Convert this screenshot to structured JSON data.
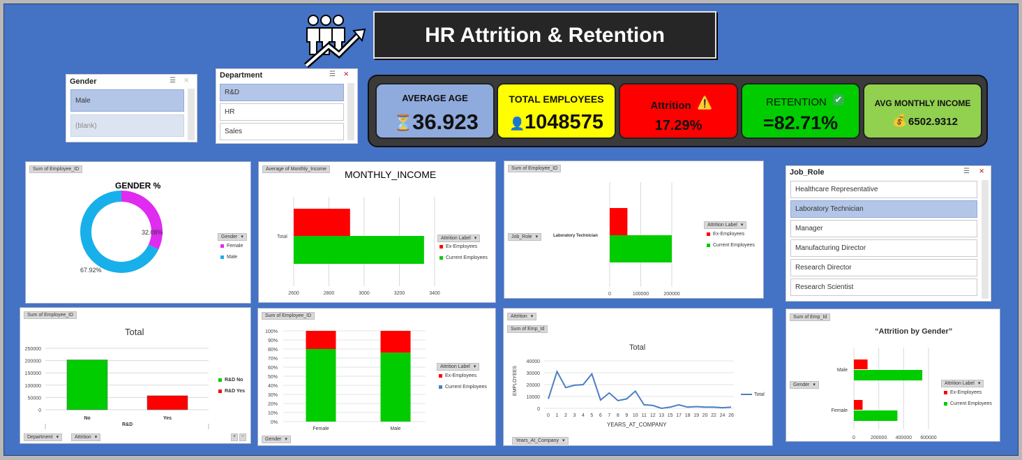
{
  "title": "HR Attrition & Retention",
  "colors": {
    "background": "#4472c4",
    "red": "#ff0000",
    "green": "#00cc00",
    "blue": "#4a7fc4",
    "magenta": "#e02bf0",
    "cyan": "#18b0ea"
  },
  "slicers": {
    "gender": {
      "title": "Gender",
      "items": [
        {
          "label": "Male",
          "state": "selected"
        },
        {
          "label": "(blank)",
          "state": "dim"
        }
      ]
    },
    "department": {
      "title": "Department",
      "items": [
        {
          "label": "R&D",
          "state": "selected"
        },
        {
          "label": "HR",
          "state": "normal"
        },
        {
          "label": "Sales",
          "state": "normal"
        }
      ]
    },
    "job_role": {
      "title": "Job_Role",
      "items": [
        {
          "label": "Healthcare Representative",
          "state": "normal"
        },
        {
          "label": "Laboratory Technician",
          "state": "selected"
        },
        {
          "label": "Manager",
          "state": "normal"
        },
        {
          "label": "Manufacturing Director",
          "state": "normal"
        },
        {
          "label": "Research Director",
          "state": "normal"
        },
        {
          "label": "Research Scientist",
          "state": "normal"
        }
      ]
    }
  },
  "kpis": {
    "avg_age": {
      "label": "AVERAGE AGE",
      "value": "36.923",
      "icon": "hourglass-icon"
    },
    "total_employees": {
      "label": "TOTAL EMPLOYEES",
      "value": "1048575",
      "icon": "person-icon"
    },
    "attrition": {
      "label": "Attrition",
      "value": "17.29%",
      "icon": "warning-icon"
    },
    "retention": {
      "label": "RETENTION",
      "value": "=82.71%",
      "icon": "check-icon"
    },
    "avg_income": {
      "label": "AVG MONTHLY INCOME",
      "value": "6502.9312",
      "icon": "money-bag-icon"
    }
  },
  "charts": {
    "gender_pct": {
      "field_button": "Sum of Employee_ID",
      "title": "GENDER %",
      "legend_button": "Gender"
    },
    "monthly_income": {
      "field_button": "Average of Monthly_Income",
      "title": "MONTHLY_INCOME",
      "legend_button": "Attrition Label",
      "category_label": "Total"
    },
    "job_role_chart": {
      "field_button": "Sum of Employee_ID",
      "axis_button": "Job_Role",
      "category_label": "Laboratory Technician",
      "legend_button": "Attrition Label"
    },
    "dept_total": {
      "field_button": "Sum of Employee_ID",
      "title": "Total",
      "axis_title": "R&D",
      "filter_buttons": [
        "Department",
        "Attrition"
      ]
    },
    "gender_stacked": {
      "field_button": "Sum of Employee_ID",
      "legend_button": "Attrition Label",
      "axis_button": "Gender"
    },
    "years_line": {
      "filter_button": "Attrition",
      "field_button": "Sum of Emp_Id",
      "title": "Total",
      "ylabel": "EMPLOYEES",
      "xlabel": "YEARS_AT_COMPANY",
      "axis_button": "Years_At_Company"
    },
    "attrition_gender": {
      "field_button": "Sum of Emp_Id",
      "title": "“Attrition by Gender”",
      "axis_button": "Gender",
      "legend_button": "Attrition Label"
    }
  },
  "chart_data": [
    {
      "type": "pie",
      "title": "GENDER %",
      "categories": [
        "Female",
        "Male"
      ],
      "values": [
        32.08,
        67.92
      ],
      "labels": [
        "32.08%",
        "67.92%"
      ],
      "colors": [
        "#e02bf0",
        "#18b0ea"
      ]
    },
    {
      "type": "bar",
      "title": "MONTHLY_INCOME",
      "categories": [
        "Total"
      ],
      "series": [
        {
          "name": "Ex-Employees",
          "values": [
            2920
          ]
        },
        {
          "name": "Current Employees",
          "values": [
            3340
          ]
        }
      ],
      "xlim": [
        2600,
        3400
      ],
      "ticks": [
        2600,
        2800,
        3000,
        3200,
        3400
      ],
      "tick_labels": [
        "2600",
        "2800",
        "3000",
        "3200",
        "3400"
      ],
      "legend": "right"
    },
    {
      "type": "bar",
      "title": "",
      "categories": [
        "Laboratory Technician"
      ],
      "series": [
        {
          "name": "Ex-Employees",
          "values": [
            57000
          ]
        },
        {
          "name": "Current Employees",
          "values": [
            200000
          ]
        }
      ],
      "xlim": [
        0,
        200000
      ],
      "ticks": [
        0,
        100000,
        200000
      ],
      "tick_labels": [
        "0",
        "100000",
        "200000"
      ],
      "legend": "right"
    },
    {
      "type": "bar",
      "title": "Total",
      "categories": [
        "No",
        "Yes"
      ],
      "series": [
        {
          "name": "R&D No",
          "values": [
            203000
          ]
        },
        {
          "name": "R&D Yes",
          "values": [
            57000
          ]
        }
      ],
      "ylim": [
        0,
        250000
      ],
      "ticks": [
        0,
        50000,
        100000,
        150000,
        200000,
        250000
      ],
      "tick_labels": [
        "0",
        "50000",
        "100000",
        "150000",
        "200000",
        "250000"
      ],
      "xlabel": "R&D",
      "legend": "right"
    },
    {
      "type": "bar",
      "title": "",
      "stacked_percent": true,
      "categories": [
        "Female",
        "Male"
      ],
      "series": [
        {
          "name": "Current Employees",
          "values": [
            80,
            76
          ]
        },
        {
          "name": "Ex-Employees",
          "values": [
            20,
            24
          ]
        }
      ],
      "ylim": [
        0,
        100
      ],
      "ticks": [
        0,
        10,
        20,
        30,
        40,
        50,
        60,
        70,
        80,
        90,
        100
      ],
      "tick_labels": [
        "0%",
        "10%",
        "20%",
        "30%",
        "40%",
        "50%",
        "60%",
        "70%",
        "80%",
        "90%",
        "100%"
      ],
      "legend": "right"
    },
    {
      "type": "line",
      "title": "Total",
      "xlabel": "YEARS_AT_COMPANY",
      "ylabel": "EMPLOYEES",
      "x": [
        "0",
        "1",
        "2",
        "3",
        "4",
        "5",
        "6",
        "7",
        "8",
        "9",
        "10",
        "11",
        "12",
        "13",
        "15",
        "17",
        "18",
        "19",
        "20",
        "22",
        "24",
        "26"
      ],
      "series": [
        {
          "name": "Total",
          "values": [
            8000,
            31000,
            17500,
            19500,
            20000,
            29000,
            7000,
            13000,
            6500,
            8000,
            14500,
            3000,
            2500,
            0,
            1000,
            3000,
            1000,
            1500,
            1000,
            1000,
            500,
            1000
          ]
        }
      ],
      "ylim": [
        0,
        40000
      ],
      "ticks": [
        0,
        10000,
        20000,
        30000,
        40000
      ],
      "tick_labels": [
        "0",
        "10000",
        "20000",
        "30000",
        "40000"
      ],
      "legend": "right"
    },
    {
      "type": "bar",
      "title": "“Attrition by Gender”",
      "categories": [
        "Male",
        "Female"
      ],
      "series": [
        {
          "name": "Ex-Employees",
          "values": [
            110000,
            70000
          ]
        },
        {
          "name": "Current Employees",
          "values": [
            550000,
            350000
          ]
        }
      ],
      "xlim": [
        0,
        600000
      ],
      "ticks": [
        0,
        200000,
        400000,
        600000
      ],
      "tick_labels": [
        "0",
        "200000",
        "400000",
        "600000"
      ],
      "legend": "right"
    }
  ]
}
